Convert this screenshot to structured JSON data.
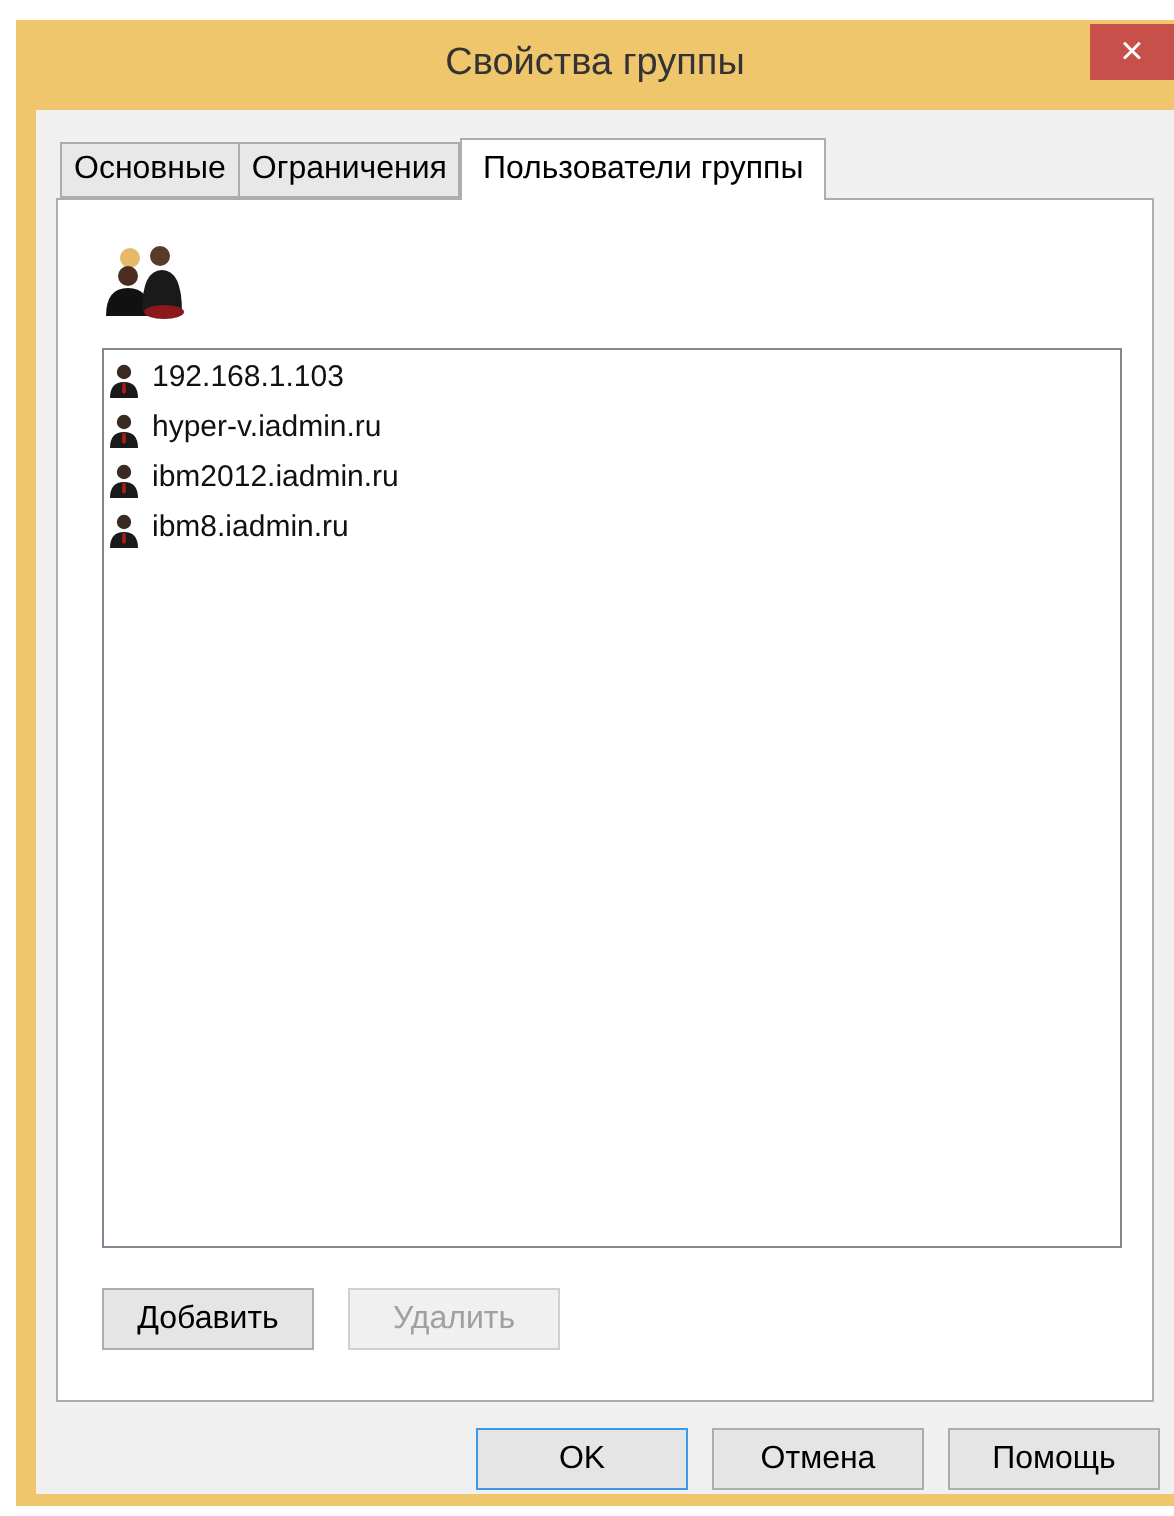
{
  "window": {
    "title": "Свойства группы",
    "close": "×"
  },
  "tabs": [
    {
      "label": "Основные",
      "selected": false
    },
    {
      "label": "Ограничения",
      "selected": false
    },
    {
      "label": "Пользователи группы",
      "selected": true
    }
  ],
  "members": [
    "192.168.1.103",
    "hyper-v.iadmin.ru",
    "ibm2012.iadmin.ru",
    "ibm8.iadmin.ru"
  ],
  "list_buttons": [
    {
      "label": "Добавить",
      "disabled": false
    },
    {
      "label": "Удалить",
      "disabled": true
    }
  ],
  "dialog_buttons": [
    {
      "label": "OK",
      "default": true
    },
    {
      "label": "Отмена",
      "default": false
    },
    {
      "label": "Помощь",
      "default": false
    }
  ]
}
